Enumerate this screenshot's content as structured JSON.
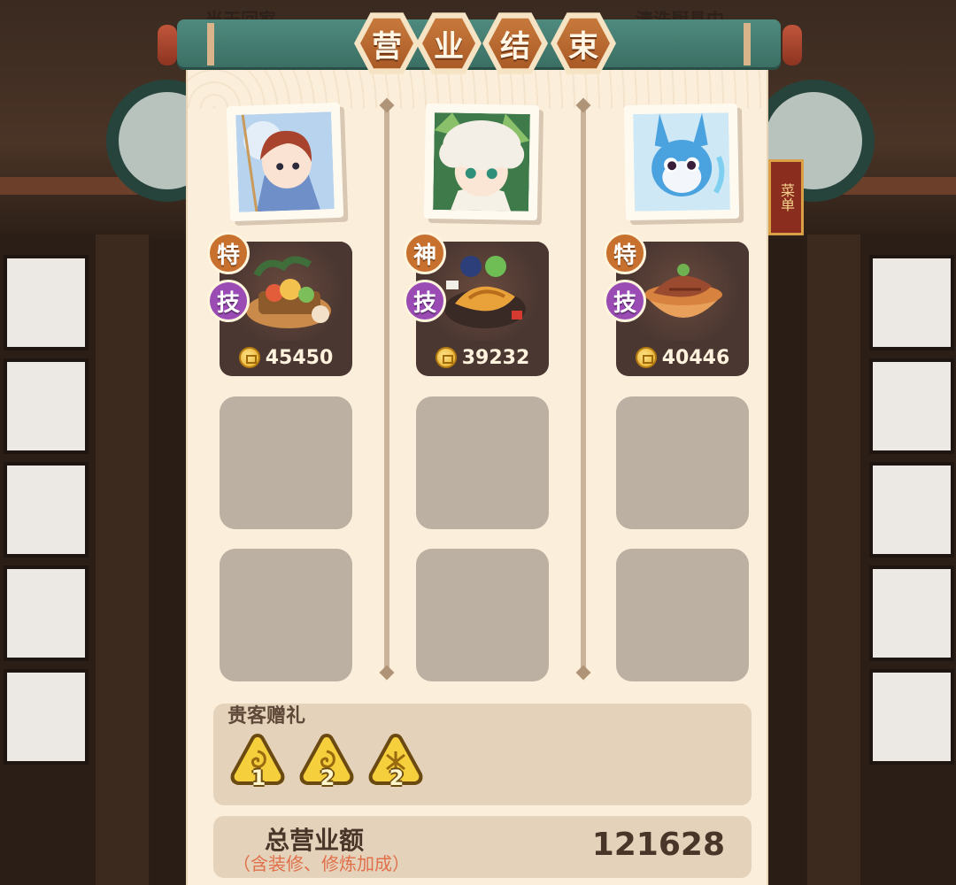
{
  "background": {
    "menu_board": "菜单",
    "top_left_text": "当天回家",
    "top_right_text": "清洗厨具中"
  },
  "title": {
    "chars": [
      "营",
      "业",
      "结",
      "束"
    ]
  },
  "chefs": [
    {
      "name": "chef-1",
      "badges": [
        "特",
        "技"
      ],
      "badge_colors": [
        "#c8702e",
        "#9a4cb4"
      ],
      "earnings": "45450",
      "dish_icon": "banquet-platter-icon"
    },
    {
      "name": "chef-2",
      "badges": [
        "神",
        "技"
      ],
      "badge_colors": [
        "#c8702e",
        "#9a4cb4"
      ],
      "earnings": "39232",
      "dish_icon": "fried-fish-platter-icon"
    },
    {
      "name": "chef-3",
      "badges": [
        "特",
        "技"
      ],
      "badge_colors": [
        "#c8702e",
        "#9a4cb4"
      ],
      "earnings": "40446",
      "dish_icon": "braised-fish-bowl-icon"
    }
  ],
  "gifts": {
    "title": "贵客赠礼",
    "items": [
      {
        "icon": "spiral-triangle-token-icon",
        "count": "1"
      },
      {
        "icon": "spiral-triangle-token-icon",
        "count": "2"
      },
      {
        "icon": "knot-triangle-token-icon",
        "count": "2"
      }
    ]
  },
  "total": {
    "label": "总营业额",
    "sub": "（含装修、修炼加成）",
    "value": "121628"
  },
  "colors": {
    "panel": "#fbeedb",
    "scroll": "#4f8a7e",
    "accent_orange": "#c8702e",
    "accent_purple": "#9a4cb4"
  }
}
